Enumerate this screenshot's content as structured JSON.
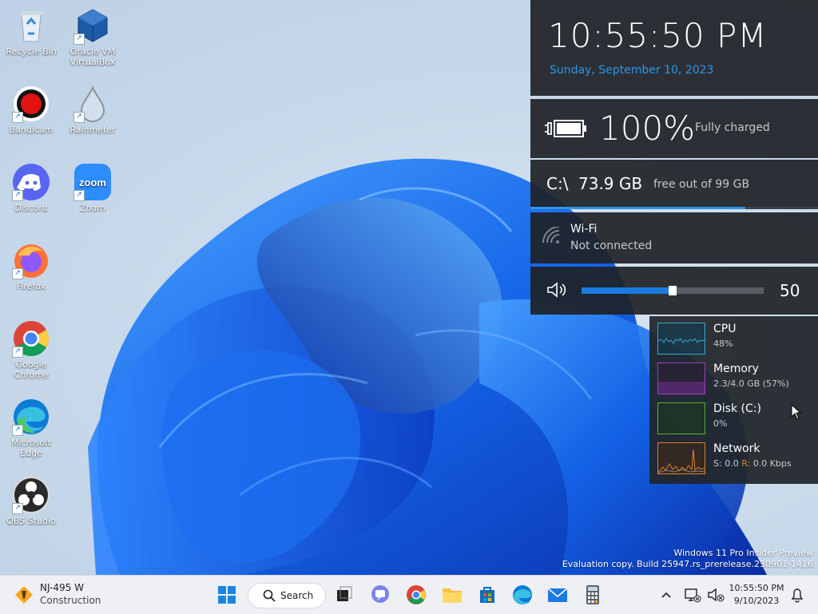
{
  "desktop_icons": [
    {
      "label": "Recycle Bin"
    },
    {
      "label": "Oracle VM VirtualBox"
    },
    {
      "label": "Bandicam"
    },
    {
      "label": "Rainmeter"
    },
    {
      "label": "Discord"
    },
    {
      "label": "Zoom"
    },
    {
      "label": "Firefox"
    },
    {
      "label": "Google Chrome"
    },
    {
      "label": "Microsoft Edge"
    },
    {
      "label": "OBS Studio"
    }
  ],
  "zoom_logo_text": "zoom",
  "clock": {
    "time": "10:55:50 PM",
    "date": "Sunday, September 10, 2023"
  },
  "battery": {
    "percent": "100%",
    "status": "Fully charged"
  },
  "disk": {
    "drive": "C:\\",
    "free": "73.9 GB",
    "total_text": "free out of 99 GB",
    "free_fraction": 0.747
  },
  "wifi": {
    "title": "Wi-Fi",
    "status": "Not connected"
  },
  "volume": {
    "value": "50",
    "level": 0.5
  },
  "system": [
    {
      "name": "CPU",
      "value": "48%",
      "color": "#3aa6d6"
    },
    {
      "name": "Memory",
      "value": "2.3/4.0 GB (57%)",
      "color": "#a23fc2"
    },
    {
      "name": "Disk (C:)",
      "value": "0%",
      "color": "#58b52c"
    },
    {
      "name": "Network",
      "send_label": "S:",
      "send_value": "0.0",
      "recv_label": "R:",
      "recv_value": "0.0 Kbps",
      "color": "#d8832a"
    }
  ],
  "watermark": {
    "line1": "Windows 11 Pro Insider Preview",
    "line2": "Evaluation copy. Build 25947.rs_prerelease.230901-1416"
  },
  "taskbar": {
    "weather_title": "NJ-495 W",
    "weather_sub": "Construction",
    "search_label": "Search",
    "tray_time": "10:55:50 PM",
    "tray_date": "9/10/2023"
  },
  "colors": {
    "accent": "#2d95e6",
    "panel_bg": "#1e2226"
  }
}
